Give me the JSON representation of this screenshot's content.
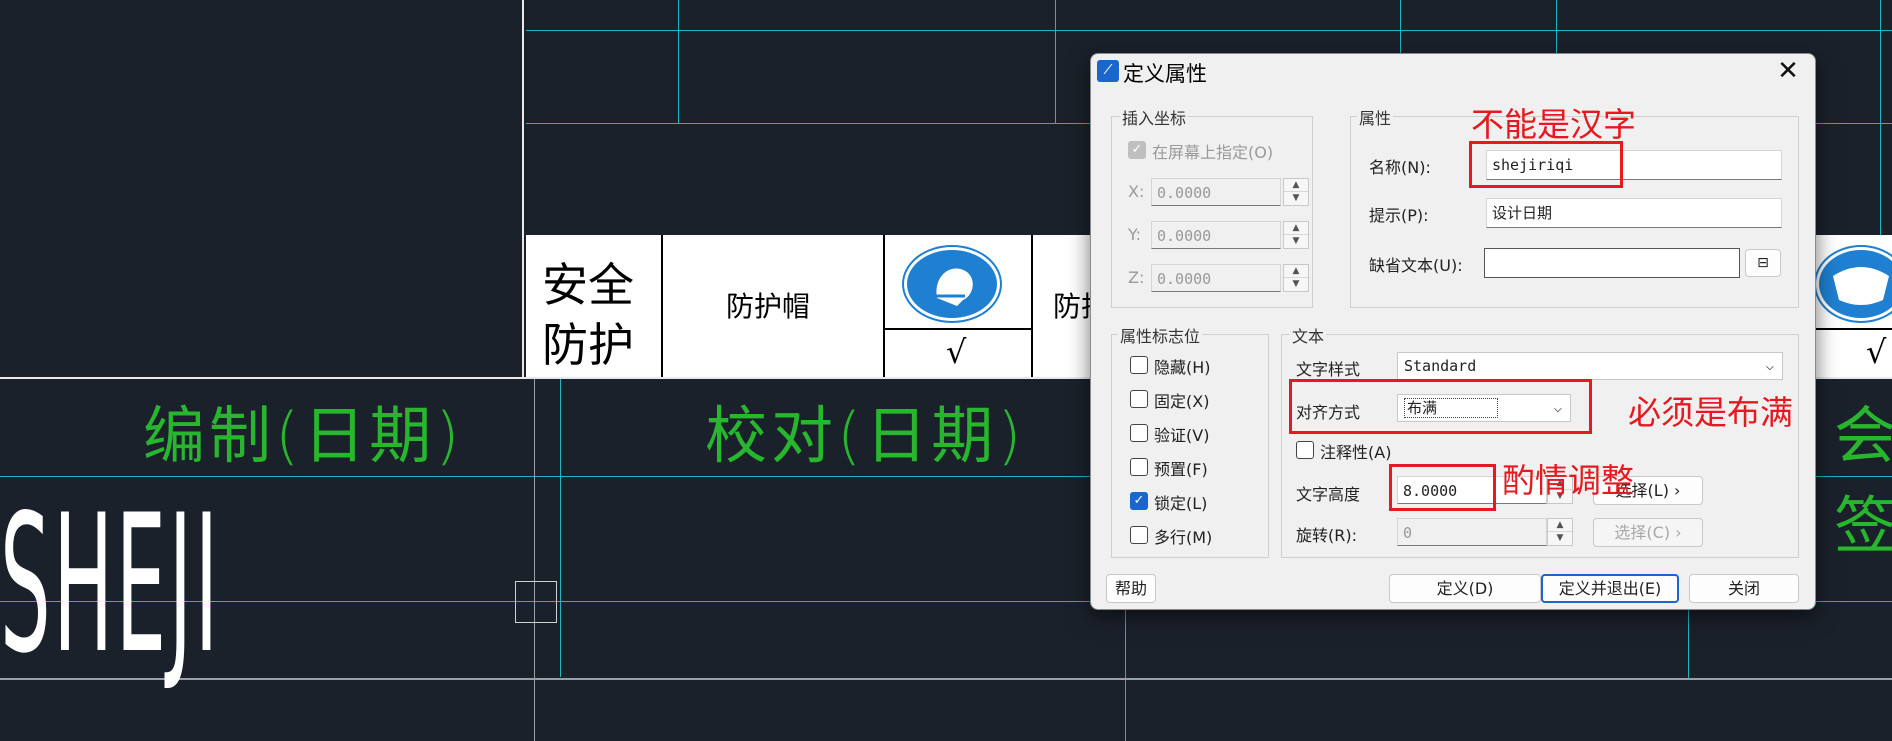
{
  "canvas": {
    "title_block": {
      "cell_safety_line1": "安全",
      "cell_safety_line2": "防护",
      "cell_helmet": "防护帽",
      "check_mark_1": "√",
      "cell_partial": "防护",
      "check_mark_2": "√"
    },
    "green_labels": {
      "compile_date": "编制(日期)",
      "check_date": "校对(日期)",
      "partial": "会签"
    },
    "big_text": "SHEJI"
  },
  "dialog": {
    "title": "定义属性",
    "close_icon": "close-icon",
    "insert_coords": {
      "title": "插入坐标",
      "on_screen_label": "在屏幕上指定(O)",
      "on_screen_checked": true,
      "x_label": "X:",
      "x_value": "0.0000",
      "y_label": "Y:",
      "y_value": "0.0000",
      "z_label": "Z:",
      "z_value": "0.0000"
    },
    "attribute": {
      "title": "属性",
      "name_label": "名称(N):",
      "name_value": "shejiriqi",
      "prompt_label": "提示(P):",
      "prompt_value": "设计日期",
      "default_label": "缺省文本(U):",
      "default_value": ""
    },
    "flags": {
      "title": "属性标志位",
      "items": [
        {
          "label": "隐藏(H)",
          "checked": false
        },
        {
          "label": "固定(X)",
          "checked": false
        },
        {
          "label": "验证(V)",
          "checked": false
        },
        {
          "label": "预置(F)",
          "checked": false
        },
        {
          "label": "锁定(L)",
          "checked": true
        },
        {
          "label": "多行(M)",
          "checked": false
        }
      ]
    },
    "text": {
      "title": "文本",
      "style_label": "文字样式",
      "style_value": "Standard",
      "align_label": "对齐方式",
      "align_value": "布满",
      "annotative_label": "注释性(A)",
      "height_label": "文字高度",
      "height_value": "8.0000",
      "rotation_label": "旋转(R):",
      "rotation_value": "0",
      "select_l_label": "选择(L)",
      "select_c_label": "选择(C)"
    },
    "buttons": {
      "help": "帮助",
      "define": "定义(D)",
      "define_exit": "定义并退出(E)",
      "close": "关闭"
    }
  },
  "annotations": {
    "name_note": "不能是汉字",
    "align_note": "必须是布满",
    "height_note": "酌情调整",
    "color": "#e5191f"
  }
}
